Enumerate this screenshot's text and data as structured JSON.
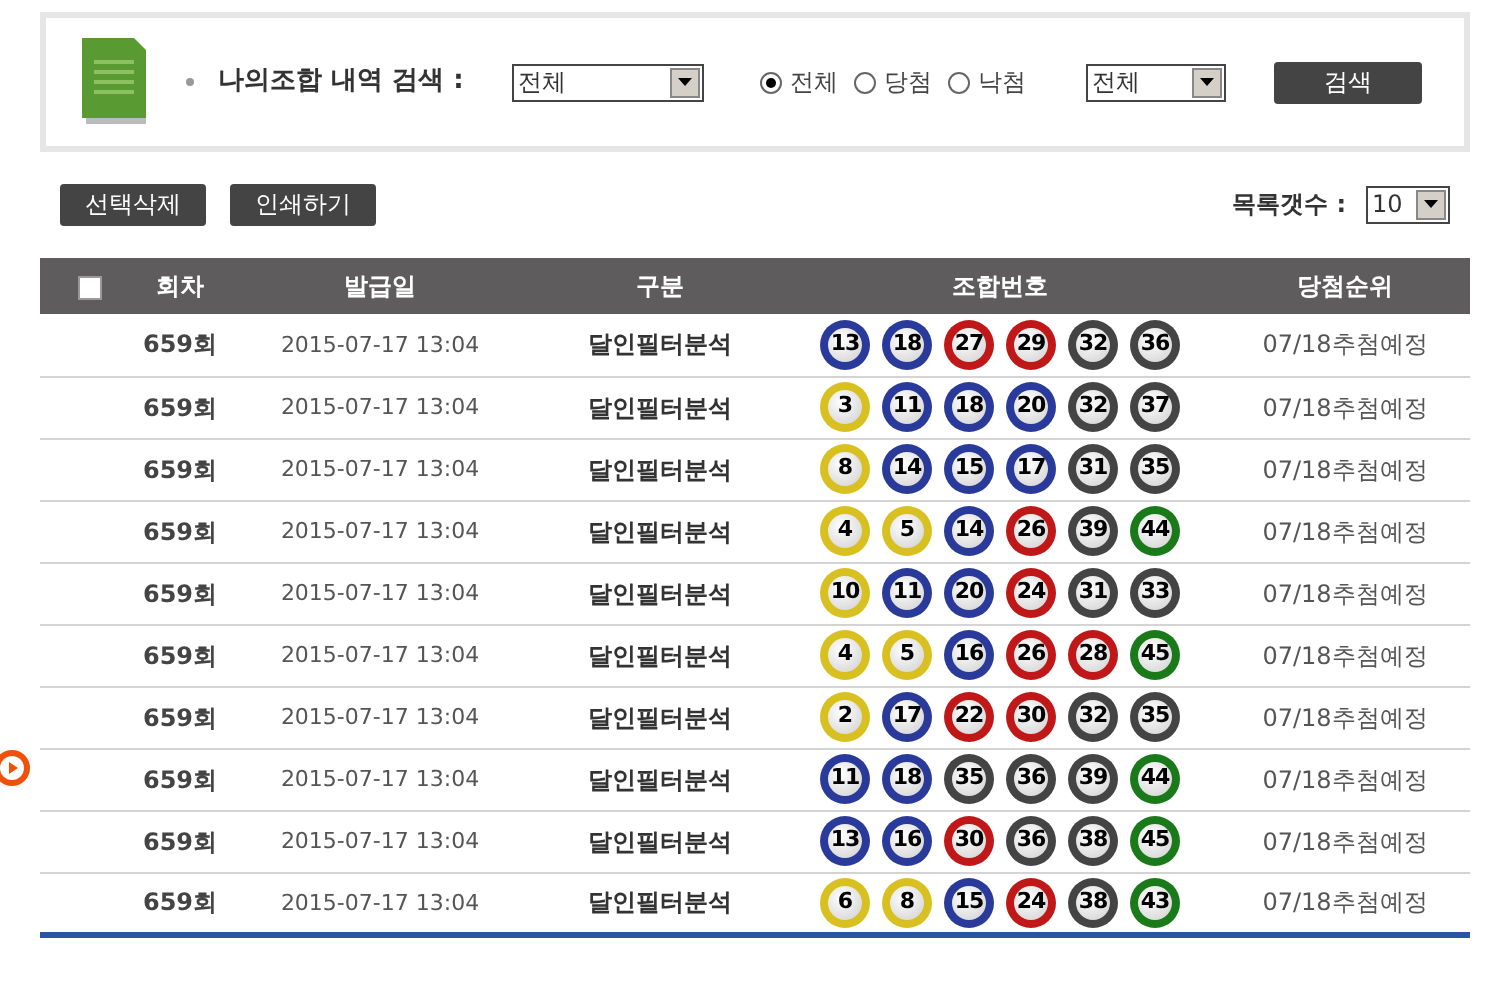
{
  "search": {
    "label": "나의조합 내역 검색 :",
    "round_select": {
      "value": "전체"
    },
    "result_filter": [
      {
        "label": "전체",
        "selected": true
      },
      {
        "label": "당첨",
        "selected": false
      },
      {
        "label": "낙첨",
        "selected": false
      }
    ],
    "type_select": {
      "value": "전체"
    },
    "search_button": "검색"
  },
  "actions": {
    "buttons": [
      "선택삭제",
      "인쇄하기"
    ],
    "page_size_label": "목록갯수 :",
    "page_size": {
      "value": "10"
    }
  },
  "table": {
    "select_all_checked": false,
    "columns": [
      "회차",
      "발급일",
      "구분",
      "조합번호",
      "당첨순위"
    ],
    "rows": [
      {
        "round": "659회",
        "date": "2015-07-17 13:04",
        "type": "달인필터분석",
        "status": "07/18추첨예정",
        "balls": [
          {
            "number": "13",
            "color": "#2a3a9a"
          },
          {
            "number": "18",
            "color": "#2a3a9a"
          },
          {
            "number": "27",
            "color": "#c01818"
          },
          {
            "number": "29",
            "color": "#c01818"
          },
          {
            "number": "32",
            "color": "#444444"
          },
          {
            "number": "36",
            "color": "#444444"
          }
        ]
      },
      {
        "round": "659회",
        "date": "2015-07-17 13:04",
        "type": "달인필터분석",
        "status": "07/18추첨예정",
        "balls": [
          {
            "number": "3",
            "color": "#d8c020"
          },
          {
            "number": "11",
            "color": "#2a3a9a"
          },
          {
            "number": "18",
            "color": "#2a3a9a"
          },
          {
            "number": "20",
            "color": "#2a3a9a"
          },
          {
            "number": "32",
            "color": "#444444"
          },
          {
            "number": "37",
            "color": "#444444"
          }
        ]
      },
      {
        "round": "659회",
        "date": "2015-07-17 13:04",
        "type": "달인필터분석",
        "status": "07/18추첨예정",
        "balls": [
          {
            "number": "8",
            "color": "#d8c020"
          },
          {
            "number": "14",
            "color": "#2a3a9a"
          },
          {
            "number": "15",
            "color": "#2a3a9a"
          },
          {
            "number": "17",
            "color": "#2a3a9a"
          },
          {
            "number": "31",
            "color": "#444444"
          },
          {
            "number": "35",
            "color": "#444444"
          }
        ]
      },
      {
        "round": "659회",
        "date": "2015-07-17 13:04",
        "type": "달인필터분석",
        "status": "07/18추첨예정",
        "balls": [
          {
            "number": "4",
            "color": "#d8c020"
          },
          {
            "number": "5",
            "color": "#d8c020"
          },
          {
            "number": "14",
            "color": "#2a3a9a"
          },
          {
            "number": "26",
            "color": "#c01818"
          },
          {
            "number": "39",
            "color": "#444444"
          },
          {
            "number": "44",
            "color": "#1a7a1a"
          }
        ]
      },
      {
        "round": "659회",
        "date": "2015-07-17 13:04",
        "type": "달인필터분석",
        "status": "07/18추첨예정",
        "balls": [
          {
            "number": "10",
            "color": "#d8c020"
          },
          {
            "number": "11",
            "color": "#2a3a9a"
          },
          {
            "number": "20",
            "color": "#2a3a9a"
          },
          {
            "number": "24",
            "color": "#c01818"
          },
          {
            "number": "31",
            "color": "#444444"
          },
          {
            "number": "33",
            "color": "#444444"
          }
        ]
      },
      {
        "round": "659회",
        "date": "2015-07-17 13:04",
        "type": "달인필터분석",
        "status": "07/18추첨예정",
        "balls": [
          {
            "number": "4",
            "color": "#d8c020"
          },
          {
            "number": "5",
            "color": "#d8c020"
          },
          {
            "number": "16",
            "color": "#2a3a9a"
          },
          {
            "number": "26",
            "color": "#c01818"
          },
          {
            "number": "28",
            "color": "#c01818"
          },
          {
            "number": "45",
            "color": "#1a7a1a"
          }
        ]
      },
      {
        "round": "659회",
        "date": "2015-07-17 13:04",
        "type": "달인필터분석",
        "status": "07/18추첨예정",
        "balls": [
          {
            "number": "2",
            "color": "#d8c020"
          },
          {
            "number": "17",
            "color": "#2a3a9a"
          },
          {
            "number": "22",
            "color": "#c01818"
          },
          {
            "number": "30",
            "color": "#c01818"
          },
          {
            "number": "32",
            "color": "#444444"
          },
          {
            "number": "35",
            "color": "#444444"
          }
        ]
      },
      {
        "round": "659회",
        "date": "2015-07-17 13:04",
        "type": "달인필터분석",
        "status": "07/18추첨예정",
        "balls": [
          {
            "number": "11",
            "color": "#2a3a9a"
          },
          {
            "number": "18",
            "color": "#2a3a9a"
          },
          {
            "number": "35",
            "color": "#444444"
          },
          {
            "number": "36",
            "color": "#444444"
          },
          {
            "number": "39",
            "color": "#444444"
          },
          {
            "number": "44",
            "color": "#1a7a1a"
          }
        ]
      },
      {
        "round": "659회",
        "date": "2015-07-17 13:04",
        "type": "달인필터분석",
        "status": "07/18추첨예정",
        "balls": [
          {
            "number": "13",
            "color": "#2a3a9a"
          },
          {
            "number": "16",
            "color": "#2a3a9a"
          },
          {
            "number": "30",
            "color": "#c01818"
          },
          {
            "number": "36",
            "color": "#444444"
          },
          {
            "number": "38",
            "color": "#444444"
          },
          {
            "number": "45",
            "color": "#1a7a1a"
          }
        ]
      },
      {
        "round": "659회",
        "date": "2015-07-17 13:04",
        "type": "달인필터분석",
        "status": "07/18추첨예정",
        "balls": [
          {
            "number": "6",
            "color": "#d8c020"
          },
          {
            "number": "8",
            "color": "#d8c020"
          },
          {
            "number": "15",
            "color": "#2a3a9a"
          },
          {
            "number": "24",
            "color": "#c01818"
          },
          {
            "number": "38",
            "color": "#444444"
          },
          {
            "number": "43",
            "color": "#1a7a1a"
          }
        ]
      }
    ]
  }
}
